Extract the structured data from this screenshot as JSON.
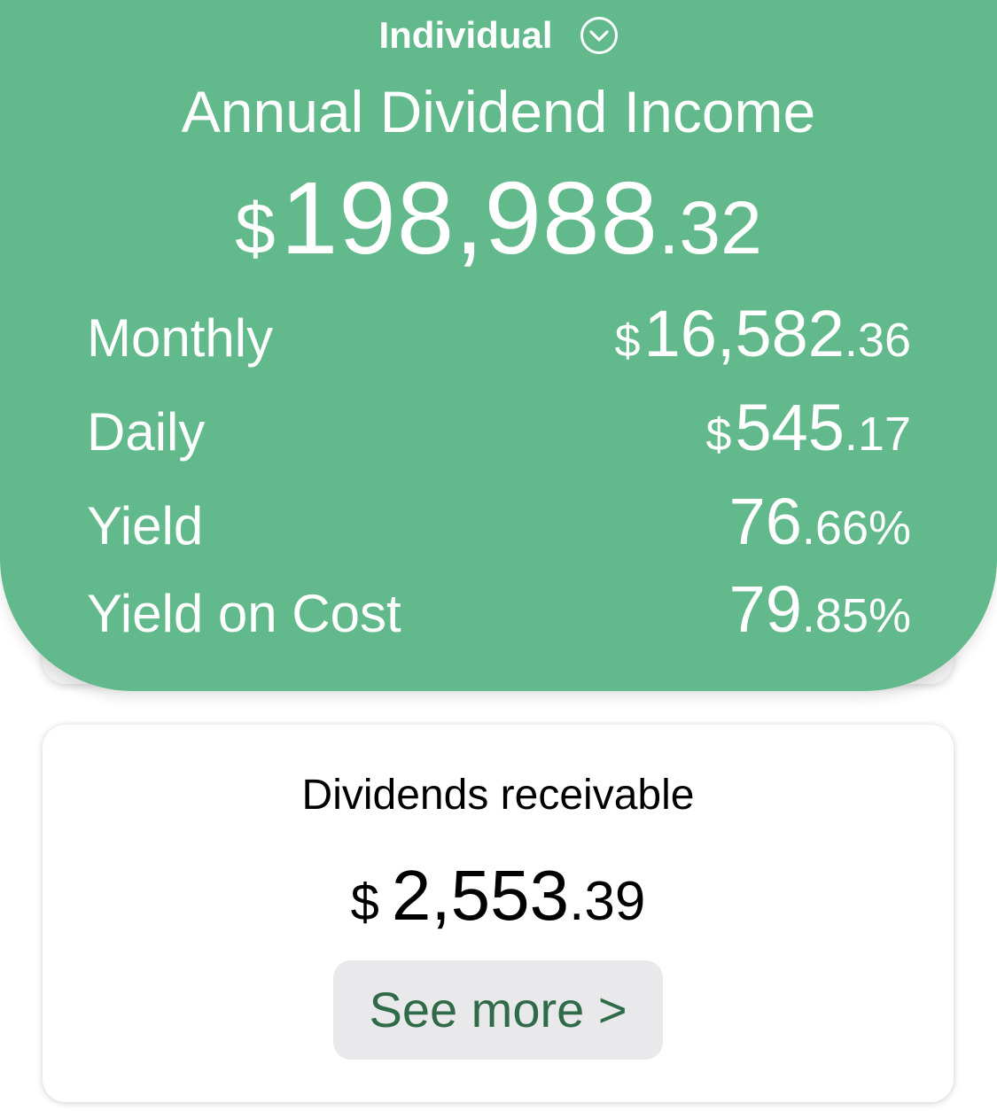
{
  "summary": {
    "account_selector": {
      "label": "Individual",
      "icon": "chevron-down-circle-icon"
    },
    "title": "Annual Dividend Income",
    "annual": {
      "currency": "$",
      "integer": "198,988",
      "decimal": ".32"
    },
    "stats": [
      {
        "label": "Monthly",
        "currency": "$",
        "integer": "16,582",
        "decimal": ".36",
        "suffix": ""
      },
      {
        "label": "Daily",
        "currency": "$",
        "integer": "545",
        "decimal": ".17",
        "suffix": ""
      },
      {
        "label": "Yield",
        "currency": "",
        "integer": "76",
        "decimal": ".66%",
        "suffix": ""
      },
      {
        "label": "Yield on Cost",
        "currency": "",
        "integer": "79",
        "decimal": ".85%",
        "suffix": ""
      }
    ]
  },
  "receivable": {
    "title": "Dividends receivable",
    "currency": "$",
    "integer": "2,553",
    "decimal": ".39",
    "see_more_label": "See more >"
  },
  "colors": {
    "panel_green": "#62b98b",
    "button_text_green": "#2f6b48",
    "button_bg": "#e9e9ec"
  }
}
